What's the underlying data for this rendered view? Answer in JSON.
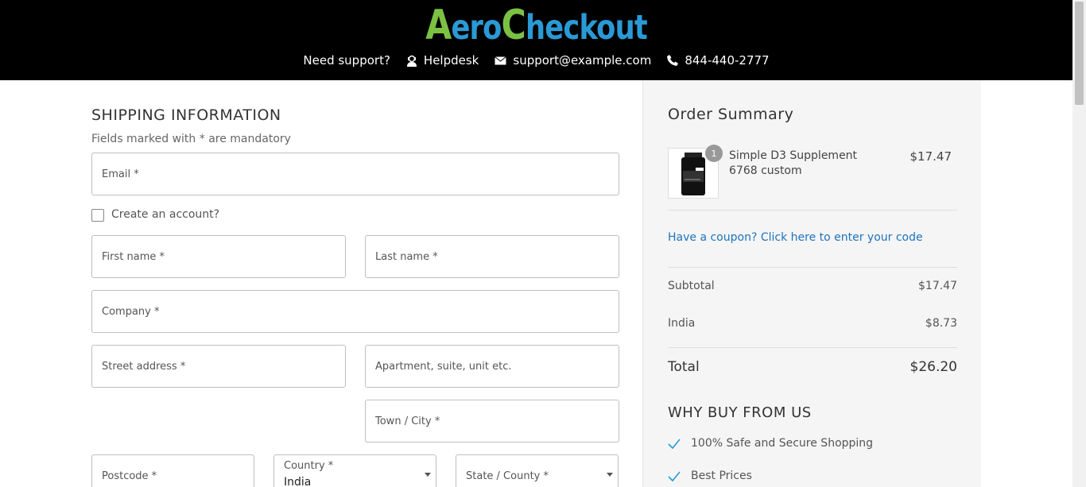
{
  "header": {
    "logo_a": "A",
    "logo_ero": "ero",
    "logo_c": "C",
    "logo_heckout": "heckout",
    "need_support": "Need support?",
    "helpdesk": "Helpdesk",
    "email": "support@example.com",
    "phone": "844-440-2777"
  },
  "shipping": {
    "title": "SHIPPING INFORMATION",
    "mandatory_note": "Fields marked with * are mandatory",
    "email_label": "Email *",
    "create_account_label": "Create an account?",
    "first_name_label": "First name *",
    "last_name_label": "Last name *",
    "company_label": "Company *",
    "street_label": "Street address *",
    "apartment_label": "Apartment, suite, unit etc.",
    "town_label": "Town / City *",
    "postcode_label": "Postcode *",
    "country_label": "Country *",
    "country_value": "India",
    "state_label": "State / County *"
  },
  "summary": {
    "title": "Order Summary",
    "item_qty": "1",
    "item_name": "Simple D3 Supplement 6768 custom",
    "item_price": "$17.47",
    "coupon_link": "Have a coupon? Click here to enter your code",
    "subtotal_label": "Subtotal",
    "subtotal_value": "$17.47",
    "shipping_label": "India",
    "shipping_value": "$8.73",
    "total_label": "Total",
    "total_value": "$26.20",
    "why_title": "WHY BUY FROM US",
    "why_items": [
      "100% Safe and Secure Shopping",
      "Best Prices"
    ]
  },
  "colors": {
    "logo_green": "#7bc142",
    "logo_blue": "#2a9ad6",
    "link_blue": "#1e73be",
    "check_blue": "#2a9ad6"
  }
}
